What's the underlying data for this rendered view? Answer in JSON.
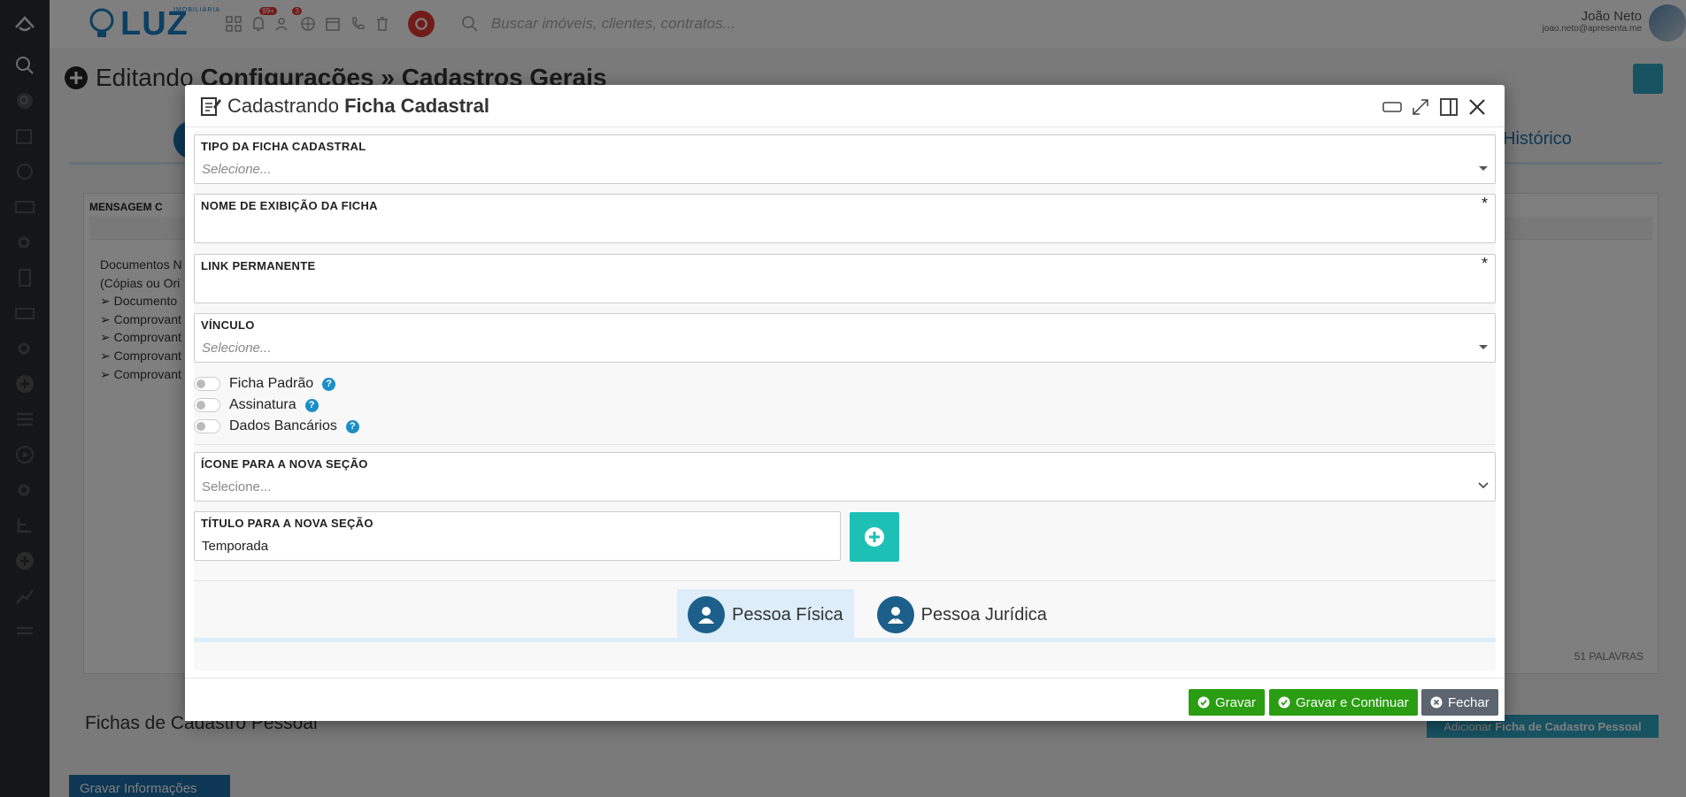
{
  "topbar": {
    "brand_small": "IMOBILIÁRIA",
    "brand_name": "LUZ",
    "notif_badge": "99+",
    "people_badge": "3",
    "search_placeholder": "Buscar imóveis, clientes, contratos...",
    "user_name": "João Neto",
    "user_email": "joao.neto@apresenta.me"
  },
  "background": {
    "title_prefix": "Editando",
    "title_bold": "Configurações » Cadastros Gerais",
    "tab_historico": "Histórico",
    "panel_heading": "MENSAGEM C",
    "doc_lines": [
      "Documentos N",
      "(Cópias ou Ori",
      "➢ Documento",
      "➢ Comprovant",
      "➢ Comprovant",
      "➢ Comprovant",
      "➢ Comprovant"
    ],
    "word_count": "51 PALAVRAS",
    "section_title": "Fichas de Cadastro Pessoal",
    "add_button_prefix": "Adicionar",
    "add_button_bold": "Ficha de Cadastro Pessoal",
    "save_info_button": "Gravar Informações"
  },
  "modal": {
    "title_prefix": "Cadastrando",
    "title_bold": "Ficha Cadastral",
    "fields": {
      "tipo": {
        "label": "TIPO DA FICHA CADASTRAL",
        "value": "Selecione..."
      },
      "nome": {
        "label": "NOME DE EXIBIÇÃO DA FICHA",
        "value": "",
        "required": "*"
      },
      "link": {
        "label": "LINK PERMANENTE",
        "value": "",
        "required": "*"
      },
      "vinculo": {
        "label": "VÍNCULO",
        "value": "Selecione..."
      },
      "icone": {
        "label": "ÍCONE PARA A NOVA SEÇÃO",
        "value": "Selecione..."
      },
      "titulo": {
        "label": "TÍTULO PARA A NOVA SEÇÃO",
        "value": "Temporada"
      }
    },
    "toggles": [
      {
        "label": "Ficha Padrão",
        "help": "?"
      },
      {
        "label": "Assinatura",
        "help": "?"
      },
      {
        "label": "Dados Bancários",
        "help": "?"
      }
    ],
    "tabs": [
      {
        "label": "Pessoa Física"
      },
      {
        "label": "Pessoa Jurídica"
      }
    ],
    "buttons": {
      "gravar": "Gravar",
      "gravar_continuar": "Gravar e Continuar",
      "fechar": "Fechar"
    }
  },
  "colors": {
    "primary": "#1b6fa8",
    "teal": "#1dc0b5",
    "green": "#2a9d12",
    "gray": "#5d6570",
    "tab_active": "#ddeefa"
  }
}
